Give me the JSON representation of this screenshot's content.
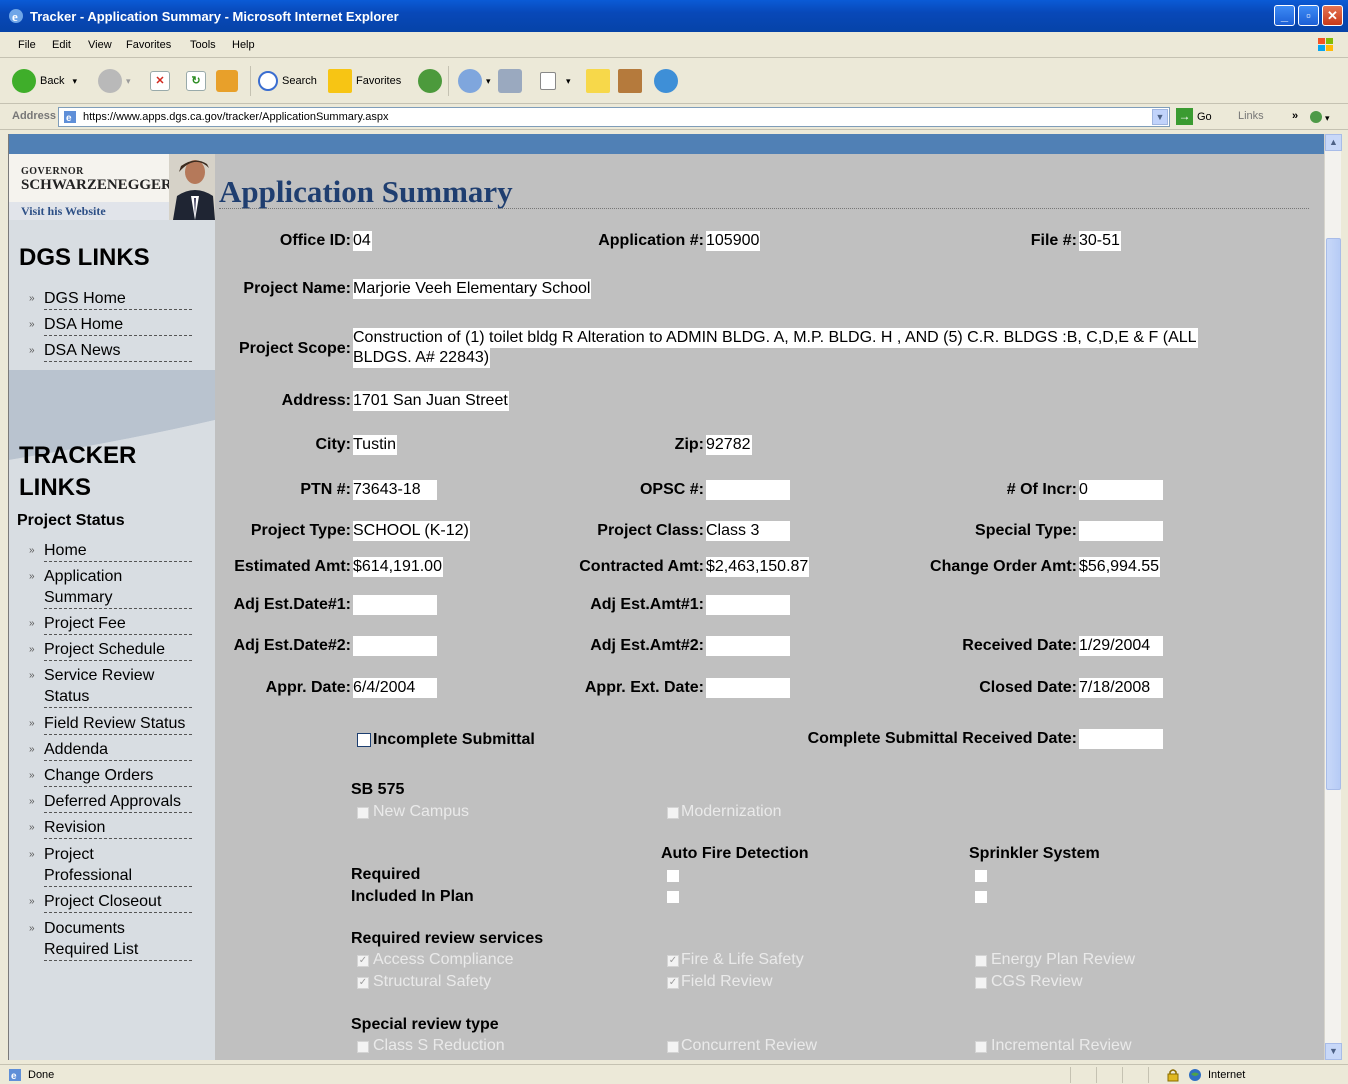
{
  "window": {
    "title": "Tracker - Application Summary - Microsoft Internet Explorer"
  },
  "menu": [
    "File",
    "Edit",
    "View",
    "Favorites",
    "Tools",
    "Help"
  ],
  "toolbar": {
    "back_label": "Back",
    "search_label": "Search",
    "favorites_label": "Favorites"
  },
  "address": {
    "label": "Address",
    "url": "https://www.apps.dgs.ca.gov/tracker/ApplicationSummary.aspx",
    "go_label": "Go",
    "links_label": "Links"
  },
  "sidebar": {
    "gov_top": "GOVERNOR",
    "gov_name": "SCHWARZENEGGER",
    "visit_label": "Visit his Website",
    "dgs_heading": "DGS LINKS",
    "dgs_links": [
      "DGS Home",
      "DSA Home",
      "DSA News"
    ],
    "tracker_heading_1": "TRACKER",
    "tracker_heading_2": "LINKS",
    "project_status": "Project Status",
    "tracker_links": [
      "Home",
      "Application",
      "Summary",
      "Project Fee",
      "Project Schedule",
      "Service Review",
      "Status",
      "Field Review Status",
      "Addenda",
      "Change Orders",
      "Deferred Approvals",
      "Revision",
      "Project",
      "Professional",
      "Project Closeout",
      "Documents",
      "Required List"
    ]
  },
  "main": {
    "title": "Application Summary",
    "labels": {
      "office_id": "Office ID:",
      "application_no": "Application #:",
      "file_no": "File #:",
      "project_name": "Project Name:",
      "project_scope": "Project Scope:",
      "address": "Address:",
      "city": "City:",
      "zip": "Zip:",
      "ptn": "PTN #:",
      "opsc": "OPSC #:",
      "of_incr": "# Of Incr:",
      "project_type": "Project Type:",
      "project_class": "Project Class:",
      "special_type": "Special Type:",
      "estimated_amt": "Estimated Amt:",
      "contracted_amt": "Contracted Amt:",
      "change_order_amt": "Change Order Amt:",
      "adj_est_date1": "Adj Est.Date#1:",
      "adj_est_amt1": "Adj Est.Amt#1:",
      "adj_est_date2": "Adj Est.Date#2:",
      "adj_est_amt2": "Adj Est.Amt#2:",
      "received_date": "Received Date:",
      "appr_date": "Appr. Date:",
      "appr_ext_date": "Appr. Ext. Date:",
      "closed_date": "Closed Date:",
      "incomplete_submittal": "Incomplete Submittal",
      "complete_submittal_received": "Complete Submittal Received Date:"
    },
    "values": {
      "office_id": "04",
      "application_no": "105900",
      "file_no": "30-51",
      "project_name": "Marjorie Veeh Elementary School",
      "project_scope_line1": "Construction of (1) toilet bldg R Alteration to ADMIN BLDG. A, M.P. BLDG. H , AND (5) C.R. BLDGS :B, C,D,E & F (ALL",
      "project_scope_line2": "BLDGS. A# 22843)",
      "address": "1701 San Juan Street",
      "city": "Tustin",
      "zip": "92782",
      "ptn": "73643-18",
      "of_incr": "0",
      "project_type": "SCHOOL (K-12)",
      "project_class": "Class 3",
      "estimated_amt": "$614,191.00",
      "contracted_amt": "$2,463,150.87",
      "change_order_amt": "$56,994.55",
      "received_date": "1/29/2004",
      "appr_date": "6/4/2004",
      "closed_date": "7/18/2008"
    },
    "sb575": {
      "heading": "SB 575",
      "new_campus": "New Campus",
      "modernization": "Modernization"
    },
    "fire": {
      "auto_fire_detection": "Auto Fire Detection",
      "sprinkler_system": "Sprinkler System",
      "required": "Required",
      "included_in_plan": "Included In Plan"
    },
    "review_services": {
      "heading": "Required review services",
      "access_compliance": "Access Compliance",
      "fire_life_safety": "Fire & Life Safety",
      "energy_plan_review": "Energy Plan Review",
      "structural_safety": "Structural Safety",
      "field_review": "Field Review",
      "cgs_review": "CGS Review"
    },
    "special_review": {
      "heading": "Special review type",
      "class_s_reduction": "Class S Reduction",
      "concurrent_review": "Concurrent Review",
      "incremental_review": "Incremental Review"
    }
  },
  "status": {
    "text": "Done",
    "zone": "Internet"
  }
}
